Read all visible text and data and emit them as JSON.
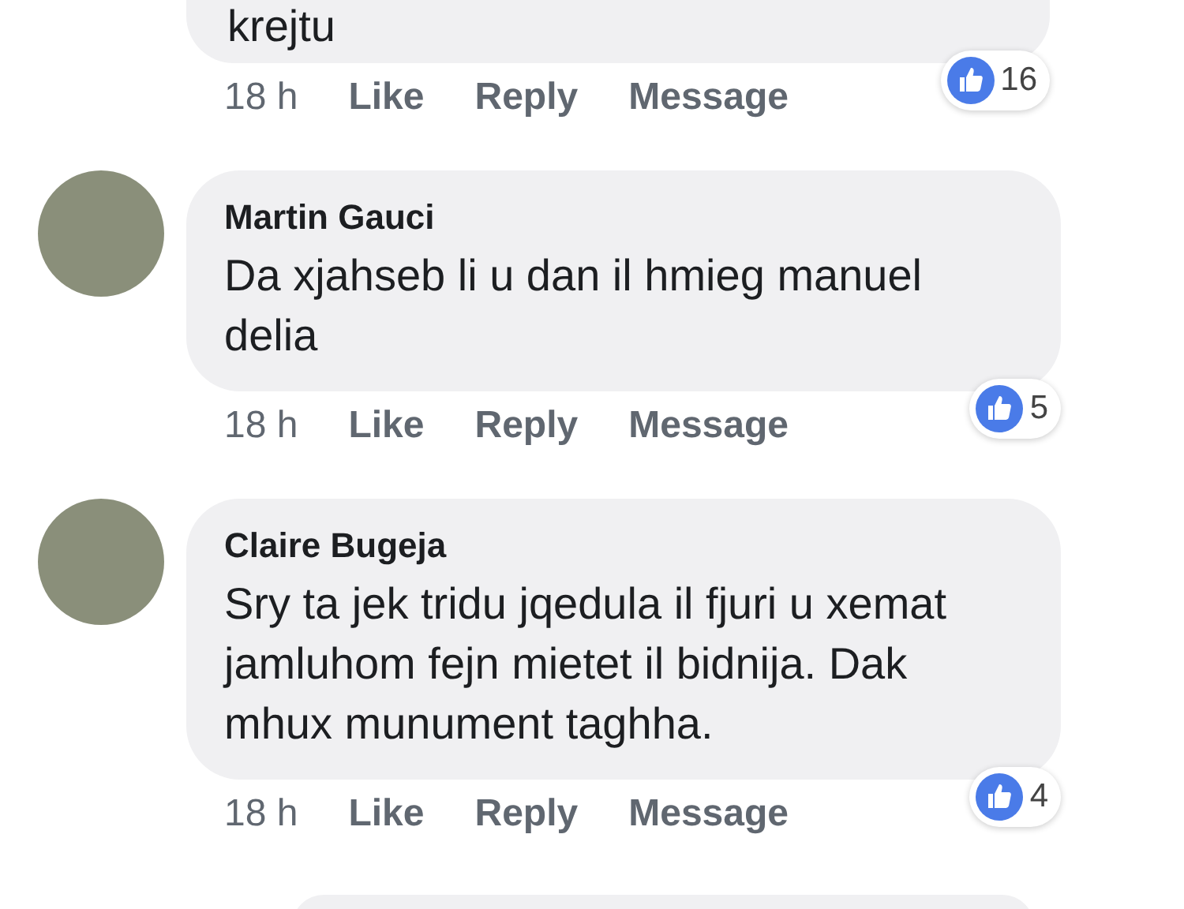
{
  "comments": [
    {
      "avatar": false,
      "text": "krejtu",
      "time": "18 h",
      "actions": [
        "Like",
        "Reply",
        "Message"
      ],
      "reaction_count": "16"
    },
    {
      "avatar": true,
      "name": "Martin Gauci",
      "text": "Da xjahseb li u dan il hmieg manuel delia",
      "time": "18 h",
      "actions": [
        "Like",
        "Reply",
        "Message"
      ],
      "reaction_count": "5"
    },
    {
      "avatar": true,
      "name": "Claire Bugeja",
      "text": "Sry ta jek tridu jqedula il fjuri u xemat jamluhom fejn mietet il bidnija. Dak mhux munument taghha.",
      "time": "18 h",
      "actions": [
        "Like",
        "Reply",
        "Message"
      ],
      "reaction_count": "4"
    }
  ]
}
